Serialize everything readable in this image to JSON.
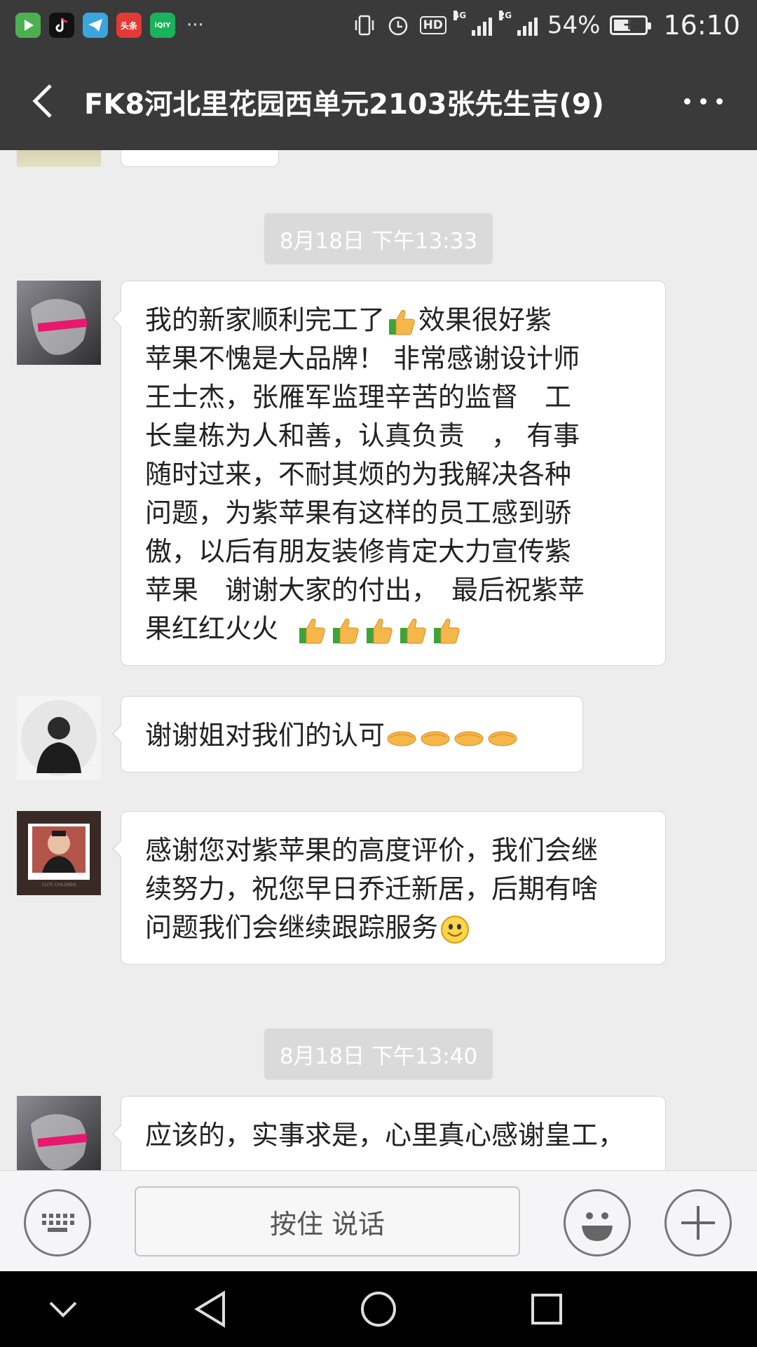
{
  "status_bar": {
    "apps": [
      {
        "name": "video-app-icon",
        "color": "#4caf50",
        "glyph": "▶"
      },
      {
        "name": "tiktok-icon",
        "color": "#222222",
        "glyph": "♪"
      },
      {
        "name": "telegram-icon",
        "color": "#3aa5de",
        "glyph": "➤"
      },
      {
        "name": "toutiao-icon",
        "color": "#e53935",
        "glyph": "头条"
      },
      {
        "name": "iqiyi-icon",
        "color": "#18b35a",
        "glyph": "iQIY"
      }
    ],
    "more_apps": "···",
    "battery_percent": "54%",
    "battery_level": 0.54,
    "time": "16:10",
    "hd_label": "HD",
    "signal_1_label": "4G",
    "signal_2_label": "2G"
  },
  "header": {
    "title": "FK8河北里花园西单元2103张先生吉(9)"
  },
  "messages": {
    "timestamp_1": "8月18日 下午13:33",
    "msg1": {
      "line1": "我的新家顺利完工了",
      "line1b": "效果很好紫",
      "body": "苹果不愧是大品牌！ 非常感谢设计师\n王士杰，张雁军监理辛苦的监督　工\n长皇栋为人和善，认真负责　， 有事\n随时过来，不耐其烦的为我解决各种\n问题，为紫苹果有这样的员工感到骄\n傲，以后有朋友装修肯定大力宣传紫\n苹果　谢谢大家的付出，　最后祝紫苹\n果红红火火  ",
      "emoji": "thumbs-up"
    },
    "msg2": {
      "text": "谢谢姐对我们的认可",
      "emoji": "handshake"
    },
    "msg3": {
      "text": "感谢您对紫苹果的高度评价，我们会继\n续努力，祝您早日乔迁新居，后期有啥\n问题我们会继续跟踪服务",
      "emoji": "smile"
    },
    "timestamp_2": "8月18日 下午13:40",
    "msg4": {
      "text": "应该的，实事求是，心里真心感谢皇工，"
    },
    "avatar_3_caption": "CUTE CHILDREN"
  },
  "input_bar": {
    "voice_label": "按住 说话"
  },
  "colors": {
    "bar_bg": "#3a3a3a",
    "chat_bg": "#ededed",
    "bubble_bg": "#ffffff"
  }
}
